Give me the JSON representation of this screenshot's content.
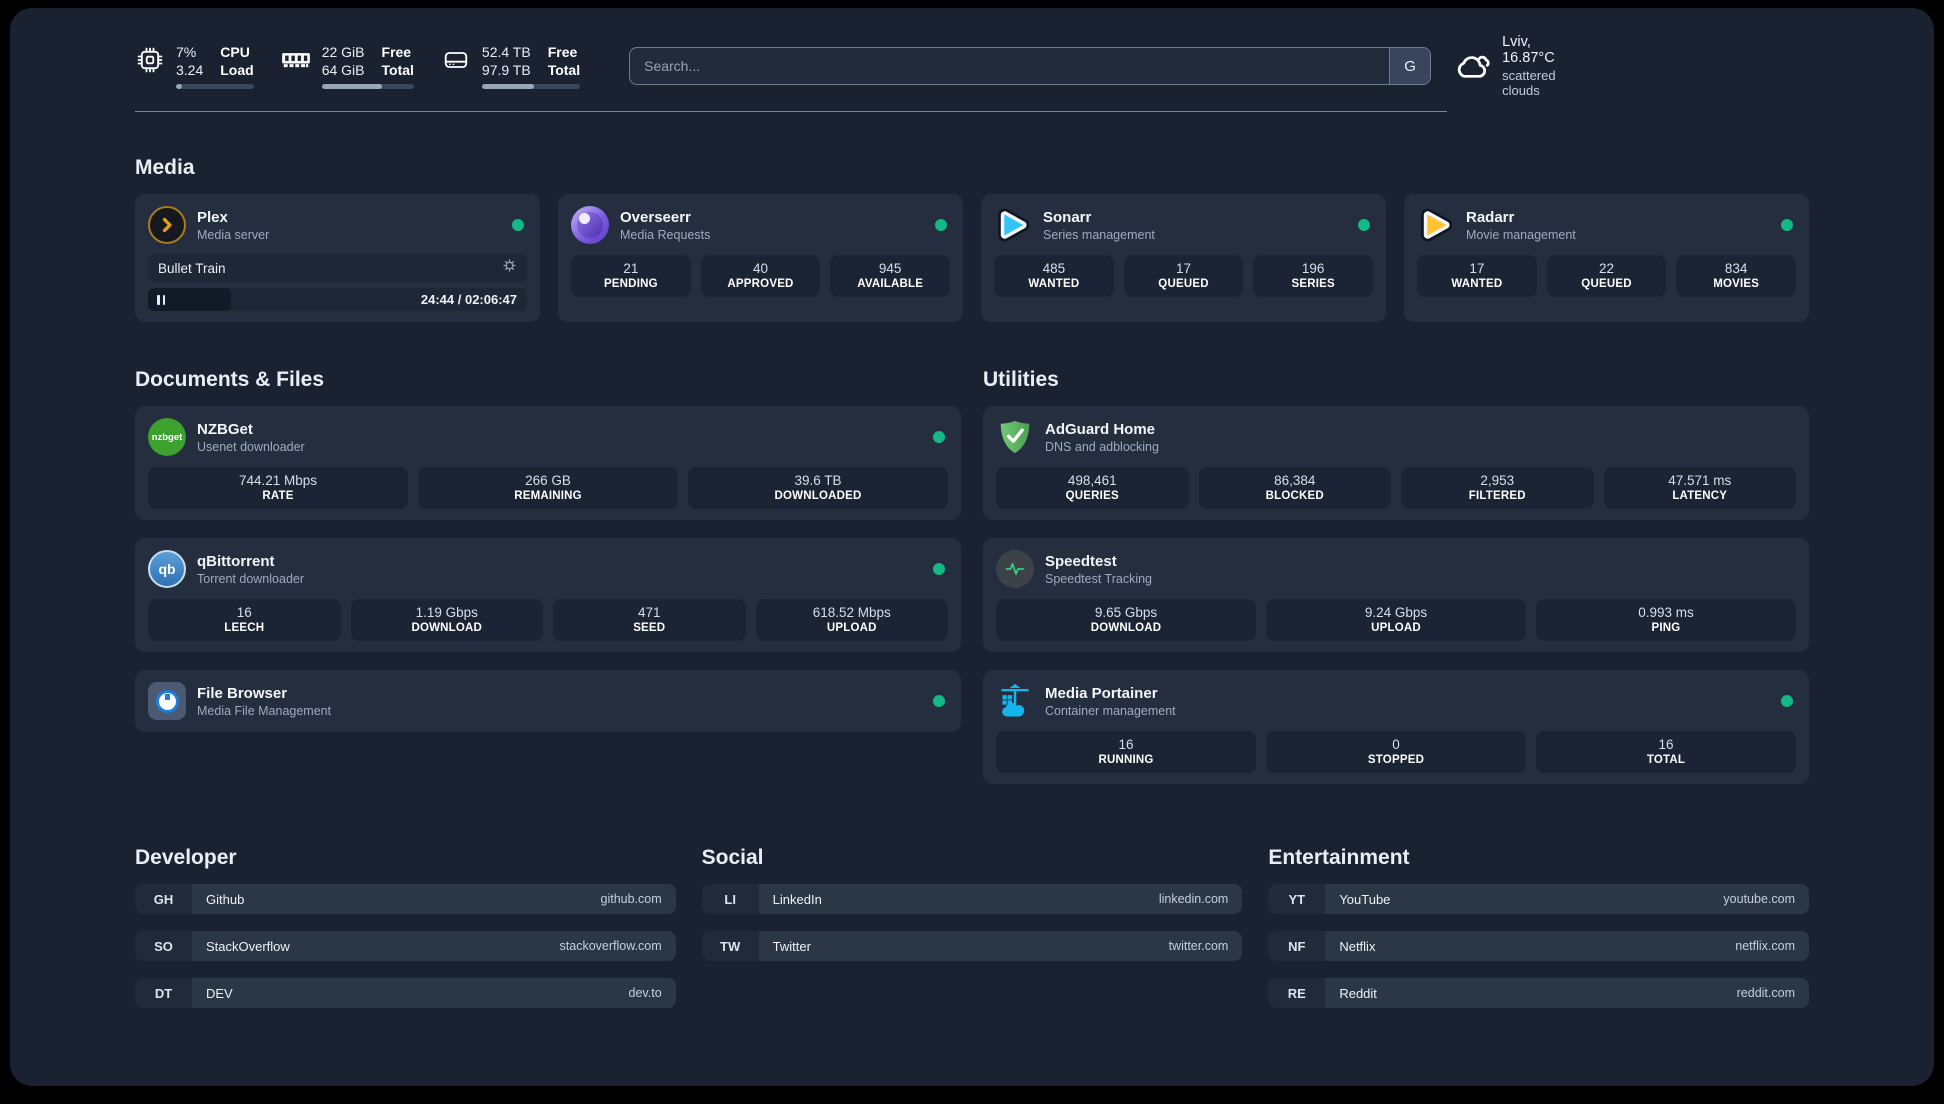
{
  "header": {
    "metrics": [
      {
        "icon": "cpu-icon",
        "values": [
          "7%",
          "3.24"
        ],
        "labels": [
          "CPU",
          "Load"
        ],
        "progress": 8
      },
      {
        "icon": "memory-icon",
        "values": [
          "22 GiB",
          "64 GiB"
        ],
        "labels": [
          "Free",
          "Total"
        ],
        "progress": 65
      },
      {
        "icon": "disk-icon",
        "values": [
          "52.4 TB",
          "97.9 TB"
        ],
        "labels": [
          "Free",
          "Total"
        ],
        "progress": 53
      }
    ],
    "search": {
      "placeholder": "Search...",
      "engine_label": "G"
    },
    "weather": {
      "icon": "cloud-icon",
      "location": "Lviv, 16.87°C",
      "condition": "scattered clouds"
    }
  },
  "sections": {
    "media": "Media",
    "documents": "Documents & Files",
    "utilities": "Utilities",
    "developer": "Developer",
    "social": "Social",
    "entertainment": "Entertainment"
  },
  "apps": {
    "plex": {
      "icon": "plex-icon",
      "name": "Plex",
      "desc": "Media server",
      "online": true,
      "player": {
        "title": "Bullet Train",
        "time": "24:44 / 02:06:47",
        "progress": 22
      }
    },
    "overseerr": {
      "icon": "overseerr-icon",
      "name": "Overseerr",
      "desc": "Media Requests",
      "online": true,
      "stats": [
        {
          "value": "21",
          "label": "PENDING"
        },
        {
          "value": "40",
          "label": "APPROVED"
        },
        {
          "value": "945",
          "label": "AVAILABLE"
        }
      ]
    },
    "sonarr": {
      "icon": "sonarr-icon",
      "name": "Sonarr",
      "desc": "Series management",
      "online": true,
      "stats": [
        {
          "value": "485",
          "label": "WANTED"
        },
        {
          "value": "17",
          "label": "QUEUED"
        },
        {
          "value": "196",
          "label": "SERIES"
        }
      ]
    },
    "radarr": {
      "icon": "radarr-icon",
      "name": "Radarr",
      "desc": "Movie management",
      "online": true,
      "stats": [
        {
          "value": "17",
          "label": "WANTED"
        },
        {
          "value": "22",
          "label": "QUEUED"
        },
        {
          "value": "834",
          "label": "MOVIES"
        }
      ]
    },
    "nzbget": {
      "icon": "nzbget-icon",
      "icon_text": "nzbget",
      "name": "NZBGet",
      "desc": "Usenet downloader",
      "online": true,
      "stats": [
        {
          "value": "744.21 Mbps",
          "label": "RATE"
        },
        {
          "value": "266 GB",
          "label": "REMAINING"
        },
        {
          "value": "39.6 TB",
          "label": "DOWNLOADED"
        }
      ]
    },
    "qbittorrent": {
      "icon": "qbittorrent-icon",
      "icon_text": "qb",
      "name": "qBittorrent",
      "desc": "Torrent downloader",
      "online": true,
      "stats": [
        {
          "value": "16",
          "label": "LEECH"
        },
        {
          "value": "1.19 Gbps",
          "label": "DOWNLOAD"
        },
        {
          "value": "471",
          "label": "SEED"
        },
        {
          "value": "618.52 Mbps",
          "label": "UPLOAD"
        }
      ]
    },
    "filebrowser": {
      "icon": "filebrowser-icon",
      "name": "File Browser",
      "desc": "Media File Management",
      "online": true
    },
    "adguard": {
      "icon": "adguard-shield-icon",
      "name": "AdGuard Home",
      "desc": "DNS and adblocking",
      "online": false,
      "stats": [
        {
          "value": "498,461",
          "label": "QUERIES"
        },
        {
          "value": "86,384",
          "label": "BLOCKED"
        },
        {
          "value": "2,953",
          "label": "FILTERED"
        },
        {
          "value": "47.571 ms",
          "label": "LATENCY"
        }
      ]
    },
    "speedtest": {
      "icon": "speedtest-pulse-icon",
      "name": "Speedtest",
      "desc": "Speedtest Tracking",
      "online": false,
      "stats": [
        {
          "value": "9.65 Gbps",
          "label": "DOWNLOAD"
        },
        {
          "value": "9.24 Gbps",
          "label": "UPLOAD"
        },
        {
          "value": "0.993 ms",
          "label": "PING"
        }
      ]
    },
    "portainer": {
      "icon": "portainer-crane-icon",
      "name": "Media Portainer",
      "desc": "Container management",
      "online": true,
      "stats": [
        {
          "value": "16",
          "label": "RUNNING"
        },
        {
          "value": "0",
          "label": "STOPPED"
        },
        {
          "value": "16",
          "label": "TOTAL"
        }
      ]
    }
  },
  "bookmarks": {
    "developer": {
      "items": [
        {
          "abbr": "GH",
          "name": "Github",
          "url": "github.com"
        },
        {
          "abbr": "SO",
          "name": "StackOverflow",
          "url": "stackoverflow.com"
        },
        {
          "abbr": "DT",
          "name": "DEV",
          "url": "dev.to"
        }
      ]
    },
    "social": {
      "items": [
        {
          "abbr": "LI",
          "name": "LinkedIn",
          "url": "linkedin.com"
        },
        {
          "abbr": "TW",
          "name": "Twitter",
          "url": "twitter.com"
        }
      ]
    },
    "entertainment": {
      "items": [
        {
          "abbr": "YT",
          "name": "YouTube",
          "url": "youtube.com"
        },
        {
          "abbr": "NF",
          "name": "Netflix",
          "url": "netflix.com"
        },
        {
          "abbr": "RE",
          "name": "Reddit",
          "url": "reddit.com"
        }
      ]
    }
  },
  "colors": {
    "status_online": "#12b886",
    "plex_gold": "#e5a00d",
    "sonarr_blue": "#35c5f4",
    "radarr_yellow": "#ffc230",
    "adguard_green": "#5fb463",
    "portainer_blue": "#13b5ea",
    "speedtest_pulse": "#2fd180",
    "page_bg": "#1a2231",
    "card_bg": "#242e3e",
    "stat_bg": "#1b2434"
  }
}
